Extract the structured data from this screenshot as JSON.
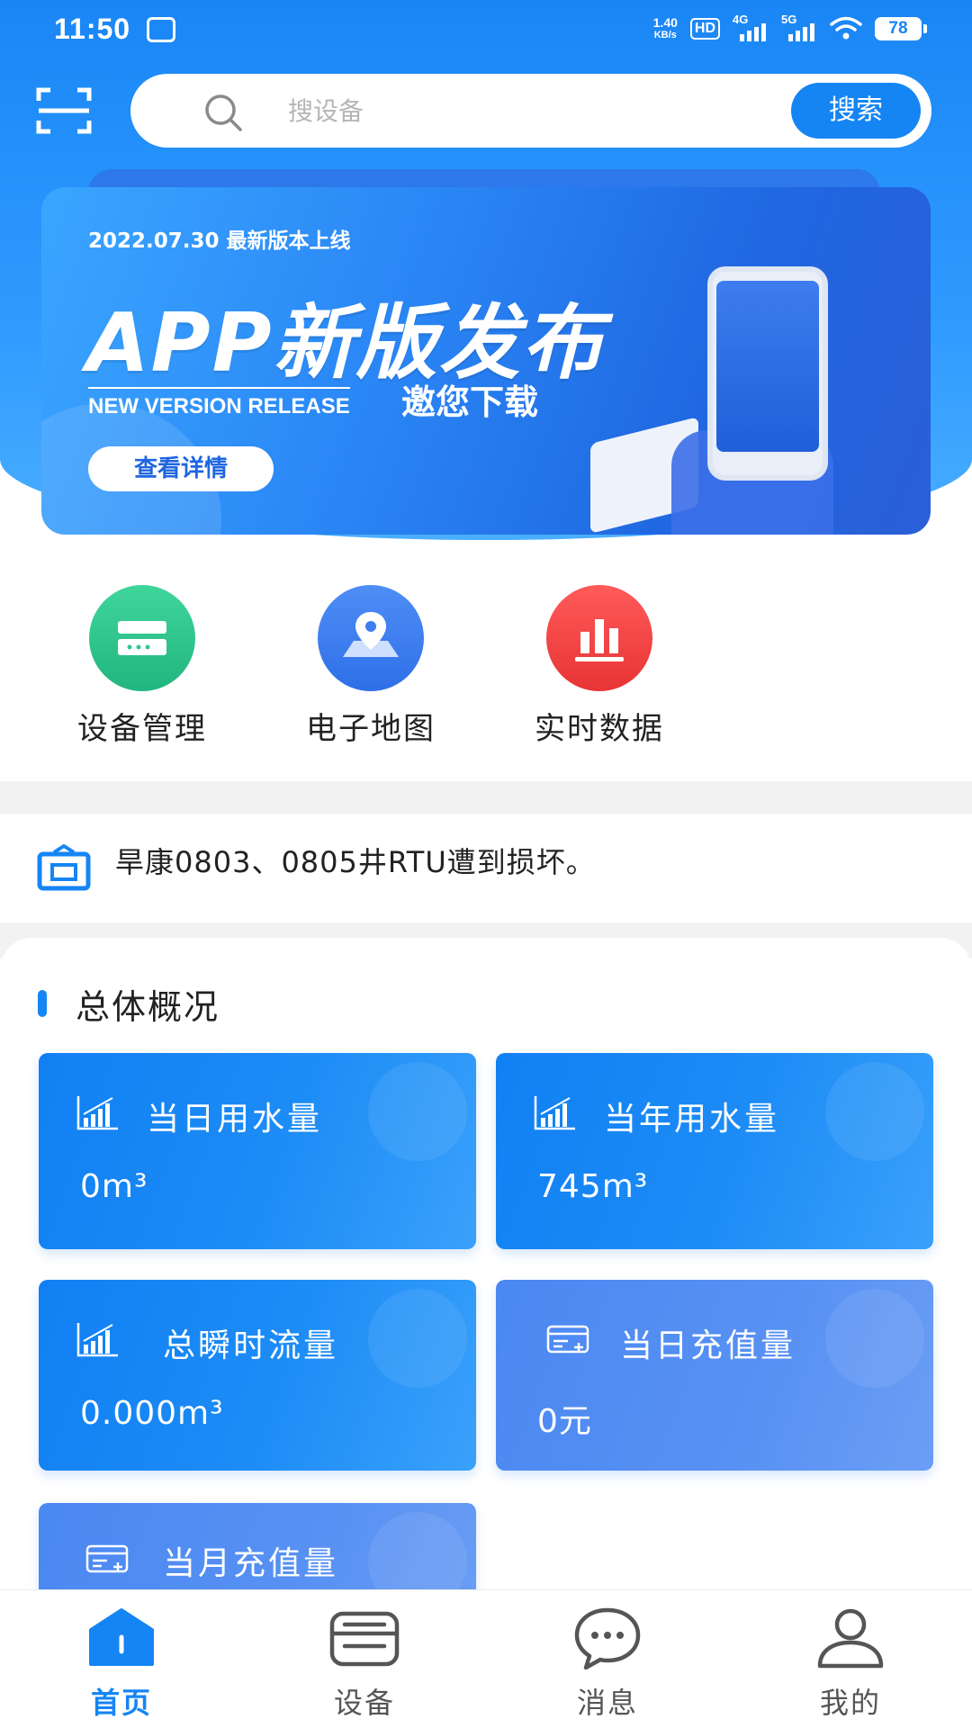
{
  "status_bar": {
    "time": "11:50",
    "net_speed_value": "1.40",
    "net_speed_unit": "KB/s",
    "hd": "HD",
    "signal1": "4G",
    "signal2": "5G",
    "battery": "78"
  },
  "search": {
    "placeholder": "搜设备",
    "button_label": "搜索"
  },
  "banner": {
    "date_text": "2022.07.30  最新版本上线",
    "title": "APP新版发布",
    "subtitle_en": "NEW VERSION RELEASE",
    "subtitle_cn": "邀您下载",
    "button_label": "查看详情"
  },
  "quick_menu": [
    {
      "label": "设备管理",
      "icon": "device-manage-icon",
      "color": "#2fc78e"
    },
    {
      "label": "电子地图",
      "icon": "map-pin-icon",
      "color": "#3d7ef2"
    },
    {
      "label": "实时数据",
      "icon": "bar-chart-icon",
      "color": "#f04848"
    }
  ],
  "notice": {
    "text": "旱康0803、0805井RTU遭到损坏。"
  },
  "overview": {
    "title": "总体概况",
    "cards": [
      {
        "label": "当日用水量",
        "value": "0m³",
        "icon": "chart-icon"
      },
      {
        "label": "当年用水量",
        "value": "745m³",
        "icon": "chart-icon"
      },
      {
        "label": "总瞬时流量",
        "value": "0.000m³",
        "icon": "chart-icon"
      },
      {
        "label": "当日充值量",
        "value": "0元",
        "icon": "card-icon"
      },
      {
        "label": "当月充值量",
        "value": "",
        "icon": "card-icon"
      }
    ]
  },
  "bottom_nav": [
    {
      "label": "首页",
      "icon": "home-icon",
      "active": true
    },
    {
      "label": "设备",
      "icon": "device-icon",
      "active": false
    },
    {
      "label": "消息",
      "icon": "message-icon",
      "active": false
    },
    {
      "label": "我的",
      "icon": "user-icon",
      "active": false
    }
  ],
  "colors": {
    "primary": "#1585f4",
    "header_gradient_top": "#1a86f5",
    "card_blue": "#1080f3",
    "card_indigo": "#4a88f2"
  }
}
